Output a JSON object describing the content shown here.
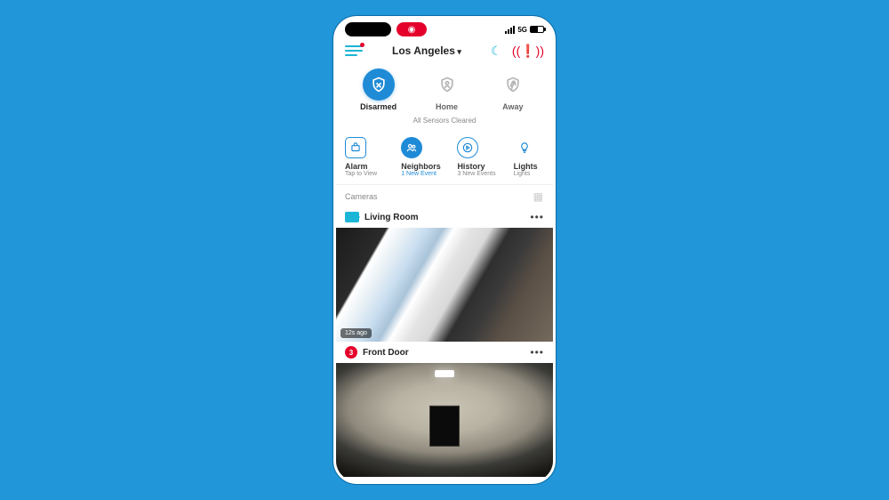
{
  "statusbar": {
    "network": "5G"
  },
  "topbar": {
    "location": "Los Angeles"
  },
  "modes": {
    "disarmed": "Disarmed",
    "home": "Home",
    "away": "Away"
  },
  "sensors_msg": "All Sensors Cleared",
  "shortcuts": {
    "alarm": {
      "title": "Alarm",
      "sub": "Tap to View"
    },
    "neighbors": {
      "title": "Neighbors",
      "sub": "1 New Event"
    },
    "history": {
      "title": "History",
      "sub": "3 New Events"
    },
    "lights": {
      "title": "Lights",
      "sub": "Lights"
    }
  },
  "cameras_heading": "Cameras",
  "cameras": [
    {
      "name": "Living Room",
      "timestamp": "12s ago"
    },
    {
      "name": "Front Door",
      "badge": "3"
    }
  ]
}
